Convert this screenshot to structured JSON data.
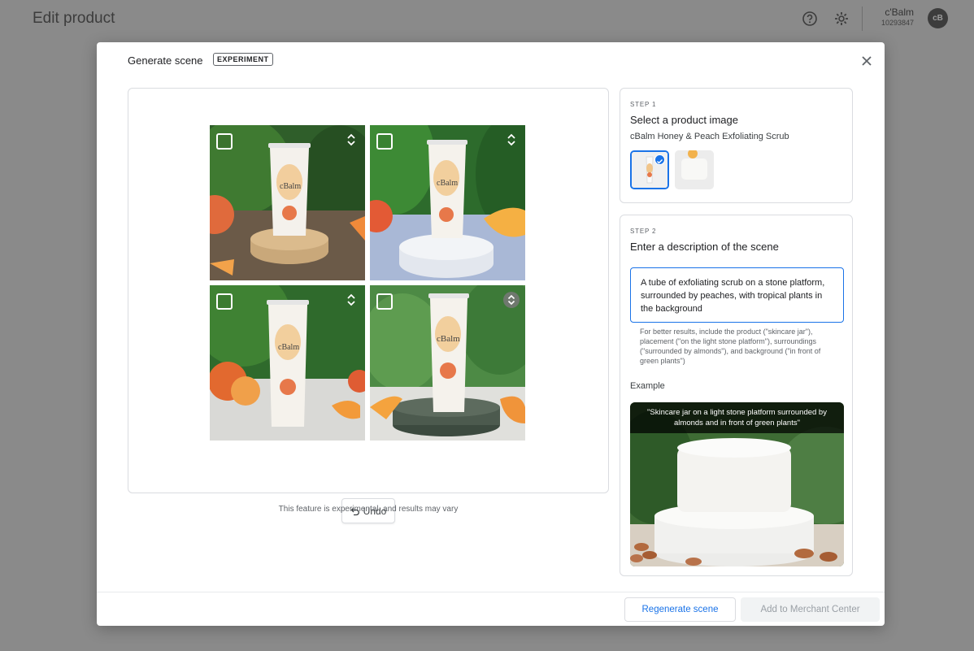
{
  "page": {
    "title": "Edit product",
    "account_name": "c'Balm",
    "account_id": "10293847",
    "avatar_text": "cB",
    "icons": [
      "help-icon",
      "settings-icon"
    ]
  },
  "dialog": {
    "title": "Generate scene",
    "badge": "EXPERIMENT",
    "close_icon": "close-icon",
    "undo_label": "Undo",
    "disclaimer": "This feature is experimental, and results may vary",
    "tiles": [
      {
        "name": "generated-image-1",
        "checked": false
      },
      {
        "name": "generated-image-2",
        "checked": false
      },
      {
        "name": "generated-image-3",
        "checked": false
      },
      {
        "name": "generated-image-4",
        "checked": false
      }
    ]
  },
  "step1": {
    "label": "STEP 1",
    "title": "Select a product image",
    "product_name": "cBalm Honey & Peach Exfoliating Scrub",
    "selected_index": 0
  },
  "step2": {
    "label": "STEP 2",
    "title": "Enter a description of the scene",
    "description": "A tube of exfoliating scrub on a stone platform, surrounded by peaches, with tropical plants in the background",
    "hint": "For better results, include the product (\"skincare jar\"), placement (\"on the light stone platform\"), surroundings (\"surrounded by almonds\"), and background (\"in front of green plants\")",
    "example_label": "Example",
    "example_caption": "\"Skincare jar on a light stone platform surrounded by almonds and in front of green plants\""
  },
  "footer": {
    "regenerate_label": "Regenerate scene",
    "add_label": "Add to Merchant Center"
  },
  "product": {
    "brand": "cBalm"
  },
  "colors": {
    "accent": "#1a73e8",
    "overlay": "#8a8a8a"
  }
}
